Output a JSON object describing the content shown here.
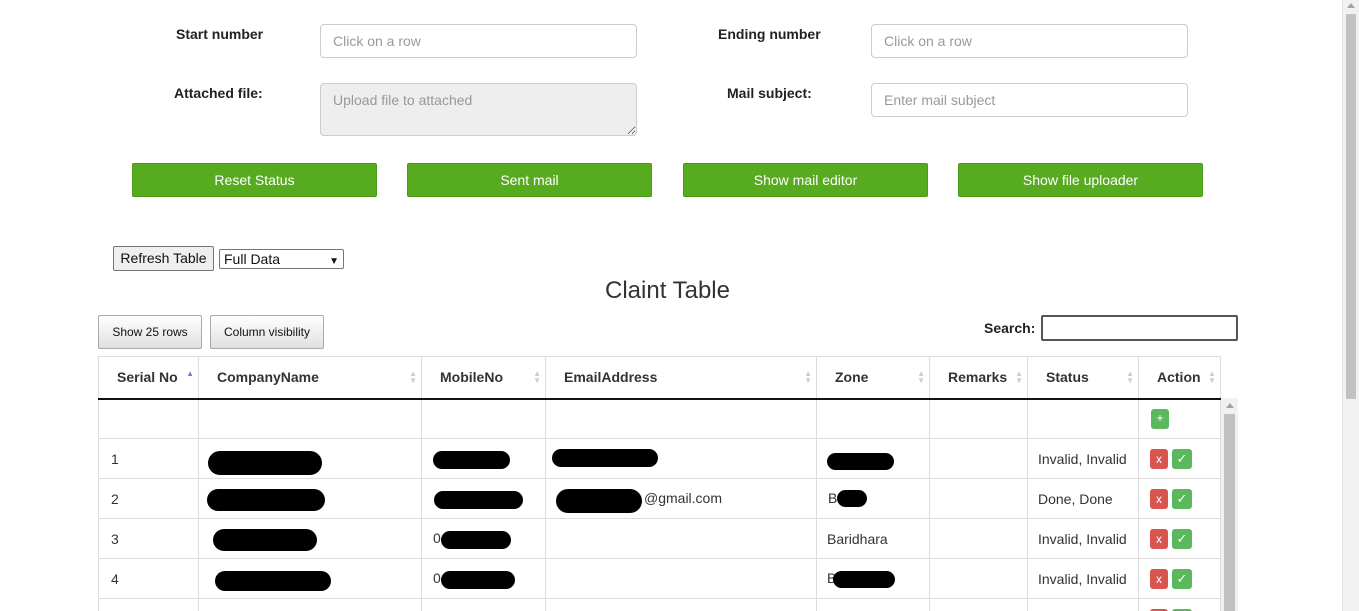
{
  "form": {
    "start_label": "Start number",
    "start_placeholder": "Click on a row",
    "ending_label": "Ending number",
    "ending_placeholder": "Click on a row",
    "attached_label": "Attached file:",
    "attached_placeholder": "Upload file to attached",
    "subject_label": "Mail subject:",
    "subject_placeholder": "Enter mail subject"
  },
  "actions": {
    "reset_status": "Reset Status",
    "sent_mail": "Sent mail",
    "show_mail_editor": "Show mail editor",
    "show_file_uploader": "Show file uploader"
  },
  "toolbar": {
    "refresh_label": "Refresh Table",
    "data_select_value": "Full Data"
  },
  "table": {
    "title": "Claint Table",
    "show_rows_label": "Show 25 rows",
    "column_visibility_label": "Column visibility",
    "search_label": "Search:",
    "headers": [
      "Serial No",
      "CompanyName",
      "MobileNo",
      "EmailAddress",
      "Zone",
      "Remarks",
      "Status",
      "Action"
    ],
    "add_button": "+",
    "delete_button": "x",
    "approve_button": "✓",
    "rows": [
      {
        "serial": "1",
        "company": "",
        "mobile": "",
        "email": "",
        "zone": "",
        "remarks": "",
        "status": "Invalid, Invalid"
      },
      {
        "serial": "2",
        "company": "",
        "mobile": "",
        "email": "@gmail.com",
        "zone": "B ara",
        "remarks": "",
        "status": "Done, Done"
      },
      {
        "serial": "3",
        "company": "",
        "mobile": "0 49",
        "email": "",
        "zone": "Baridhara",
        "remarks": "",
        "status": "Invalid, Invalid"
      },
      {
        "serial": "4",
        "company": "",
        "mobile": "0 8",
        "email": "",
        "zone": "B",
        "remarks": "",
        "status": "Invalid, Invalid"
      }
    ]
  },
  "colors": {
    "button_green": "#57ab1f",
    "danger_red": "#d9534f",
    "success_green": "#5cb85c",
    "sort_active": "#6f7cc9"
  }
}
